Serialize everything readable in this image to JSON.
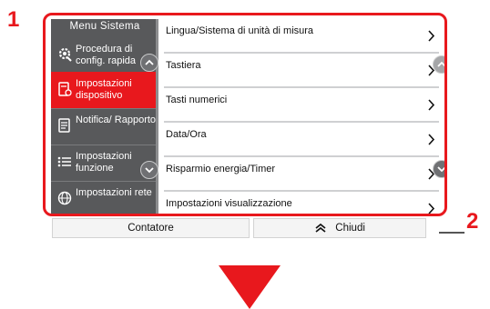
{
  "callouts": {
    "one": "1",
    "two": "2"
  },
  "sidebar": {
    "title": "Menu Sistema",
    "items": [
      {
        "label": "Procedura di config. rapida",
        "icon": "quick-setup-icon",
        "active": false
      },
      {
        "label": "Impostazioni dispositivo",
        "icon": "device-settings-icon",
        "active": true
      },
      {
        "label": "Notifica/ Rapporto",
        "icon": "report-icon",
        "active": false
      },
      {
        "label": "Impostazioni funzione",
        "icon": "function-list-icon",
        "active": false
      },
      {
        "label": "Impostazioni rete",
        "icon": "network-globe-icon",
        "active": false
      }
    ]
  },
  "list": {
    "items": [
      "Lingua/Sistema di unità di misura",
      "Tastiera",
      "Tasti numerici",
      "Data/Ora",
      "Risparmio energia/Timer",
      "Impostazioni visualizzazione"
    ]
  },
  "footer": {
    "counter_label": "Contatore",
    "close_label": "Chiudi"
  },
  "colors": {
    "accent": "#e8181d",
    "sidebar": "#58595b"
  }
}
